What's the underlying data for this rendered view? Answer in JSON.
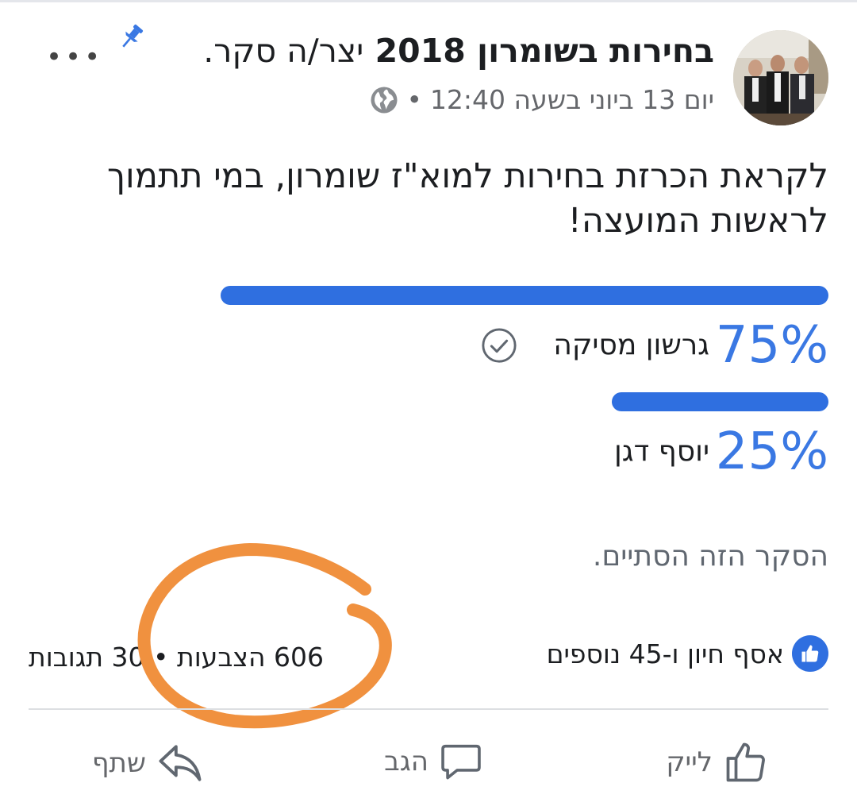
{
  "post": {
    "author": "בחירות בשומרון 2018",
    "action": "יצר/ה סקר.",
    "timestamp": "יום 13 ביוני בשעה 12:40",
    "separator": "•",
    "question": "לקראת הכרזת בחירות למוא\"ז שומרון, במי תתמוך לראשות המועצה!"
  },
  "poll": {
    "options": [
      {
        "percent": "75%",
        "percent_value": 75,
        "label": "גרשון מסיקה",
        "selected": true
      },
      {
        "percent": "25%",
        "percent_value": 25,
        "label": "יוסף דגן",
        "selected": false
      }
    ],
    "status": "הסקר הזה הסתיים."
  },
  "stats": {
    "likes_text": "אסף חיון ו-45 נוספים",
    "votes_text": "606 הצבעות",
    "comments_text": "30 תגובות",
    "separator": "•"
  },
  "actions": {
    "like": "לייק",
    "comment": "הגב",
    "share": "שתף"
  },
  "colors": {
    "accent": "#2f6fe0",
    "annotation": "#f0913f"
  },
  "icons": [
    "push-pin-icon",
    "more-icon",
    "globe-icon",
    "check-circle-icon",
    "thumbs-up-icon",
    "comment-icon",
    "share-icon"
  ]
}
